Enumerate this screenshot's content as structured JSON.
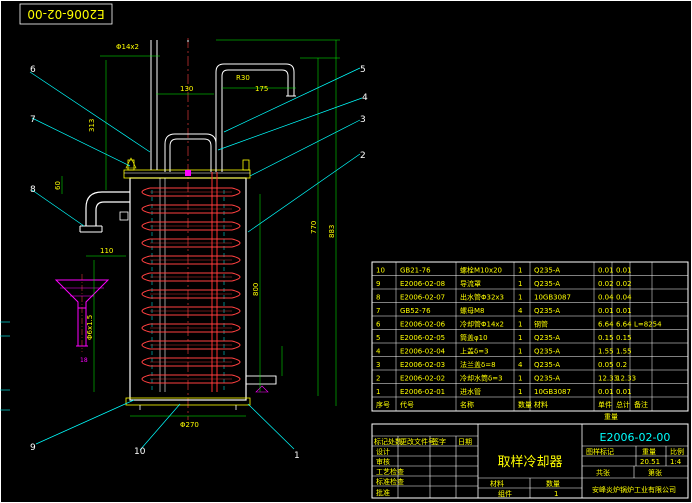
{
  "drawing_no_rotated": "E2006-02-00",
  "drawing_no": "E2006-02-00",
  "title": "取样冷却器",
  "company": "安峰炎炉锅炉工业有限公司",
  "material_value": "组件",
  "quantity_value": "1",
  "scale_value": "1:4",
  "weight_value": "20.51",
  "leaders": [
    "1",
    "2",
    "3",
    "4",
    "5",
    "6",
    "7",
    "8",
    "9",
    "10"
  ],
  "dims": {
    "d1": "Φ14x2",
    "d2": "130",
    "d3": "R30",
    "d4": "175",
    "d5": "313",
    "d6": "770",
    "d7": "883",
    "d8": "800",
    "d9": "110",
    "d10": "Φ270",
    "d11": "60",
    "d12": "18",
    "d13": "Φ6x1.5"
  },
  "bom_rows": [
    {
      "no": "10",
      "code": "GB21-76",
      "name": "螺栓M10x20",
      "qty": "1",
      "mat": "Q235-A",
      "w1": "0.01",
      "w2": "0.01",
      "note": ""
    },
    {
      "no": "9",
      "code": "E2006-02-08",
      "name": "导流罩",
      "qty": "1",
      "mat": "Q235-A",
      "w1": "0.02",
      "w2": "0.02",
      "note": ""
    },
    {
      "no": "8",
      "code": "E2006-02-07",
      "name": "出水管Φ32x3",
      "qty": "1",
      "mat": "10GB3087",
      "w1": "0.04",
      "w2": "0.04",
      "note": ""
    },
    {
      "no": "7",
      "code": "GB52-76",
      "name": "螺母M8",
      "qty": "4",
      "mat": "Q235-A",
      "w1": "0.01",
      "w2": "0.01",
      "note": ""
    },
    {
      "no": "6",
      "code": "E2006-02-06",
      "name": "冷却管Φ14x2",
      "qty": "1",
      "mat": "钢管",
      "w1": "6.64",
      "w2": "6.64",
      "note": "L=8254"
    },
    {
      "no": "5",
      "code": "E2006-02-05",
      "name": "筒盖φ10",
      "qty": "1",
      "mat": "Q235-A",
      "w1": "0.15",
      "w2": "0.15",
      "note": ""
    },
    {
      "no": "4",
      "code": "E2006-02-04",
      "name": "上盖δ=3",
      "qty": "1",
      "mat": "Q235-A",
      "w1": "1.55",
      "w2": "1.55",
      "note": ""
    },
    {
      "no": "3",
      "code": "E2006-02-03",
      "name": "法兰盖δ=8",
      "qty": "4",
      "mat": "Q235-A",
      "w1": "0.05",
      "w2": "0.2",
      "note": ""
    },
    {
      "no": "2",
      "code": "E2006-02-02",
      "name": "冷却水筒δ=3",
      "qty": "1",
      "mat": "Q235-A",
      "w1": "12.33",
      "w2": "12.33",
      "note": ""
    },
    {
      "no": "1",
      "code": "E2006-02-01",
      "name": "进水管",
      "qty": "1",
      "mat": "10GB3087",
      "w1": "0.01",
      "w2": "0.01",
      "note": ""
    }
  ],
  "bom_header": {
    "no": "序号",
    "code": "代号",
    "name": "名称",
    "qty": "数量",
    "mat": "材料",
    "w1": "单件",
    "w2": "总计",
    "weight": "重量",
    "note": "备注"
  },
  "tb_labels": {
    "mark": "标记处数",
    "change": "更改文件号",
    "sign": "签字",
    "date": "日期",
    "design": "设计",
    "check": "审核",
    "craft": "工艺检查",
    "std": "标准检查",
    "approve": "批准",
    "sheet_mark": "图样标记",
    "weight": "重量",
    "scale": "比例",
    "sheet": "共张",
    "page": "第张",
    "material": "材料",
    "quantity": "数量"
  }
}
